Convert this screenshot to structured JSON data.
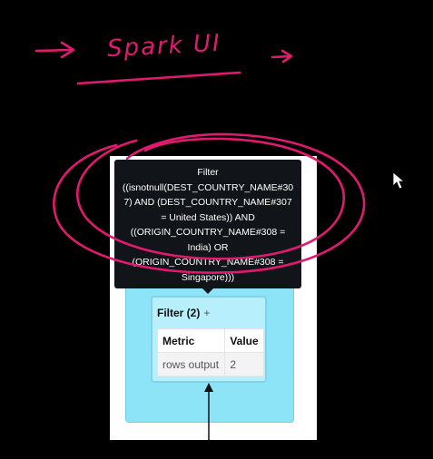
{
  "annotation": {
    "handwritten_text": "Spark UI",
    "color": "#e01a6f"
  },
  "tooltip": {
    "lines": [
      "Filter",
      "((isnotnull(DEST_COUNTRY_NAME#30",
      "7) AND (DEST_COUNTRY_NAME#307",
      "= United States)) AND",
      "((ORIGIN_COUNTRY_NAME#308 =",
      "India) OR",
      "(ORIGIN_COUNTRY_NAME#308 =",
      "Singapore)))"
    ]
  },
  "node": {
    "title": "Filter (2)",
    "expand_symbol": "+",
    "table": {
      "headers": [
        "Metric",
        "Value"
      ],
      "rows": [
        [
          "rows output",
          "2"
        ]
      ]
    }
  },
  "colors": {
    "stage_bg": "#8ee4f7",
    "node_bg": "#b7effc",
    "tooltip_bg": "#111418",
    "panel_bg": "#ffffff"
  }
}
